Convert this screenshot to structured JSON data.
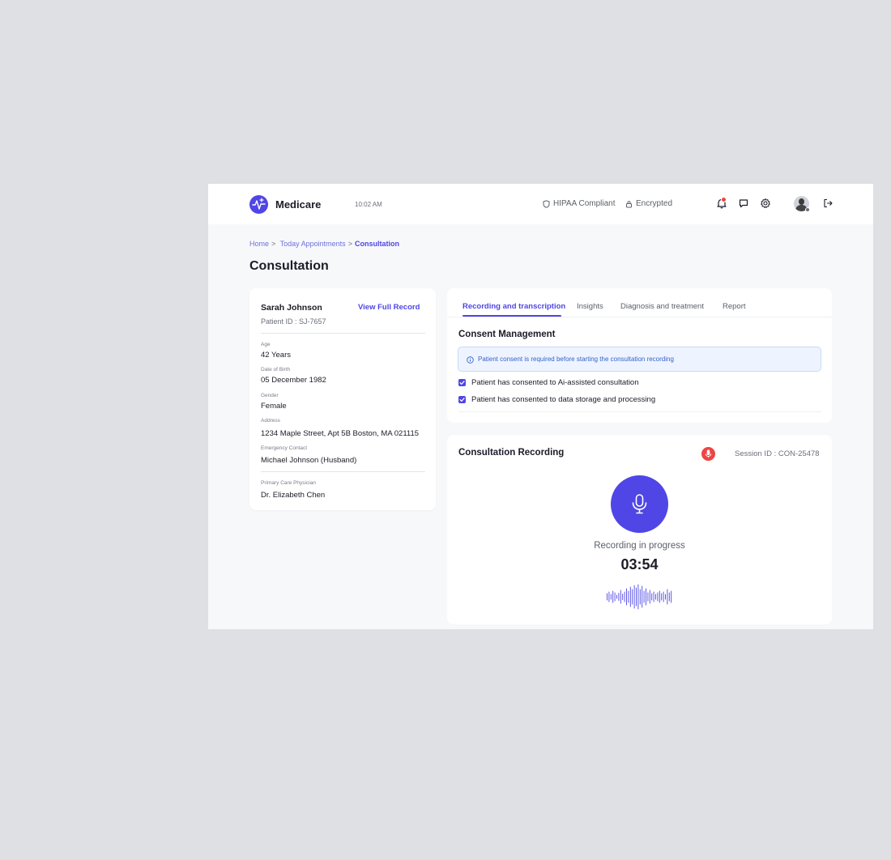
{
  "header": {
    "brand": "Medicare",
    "time": "10:02 AM",
    "hipaa": "HIPAA Compliant",
    "encrypted": "Encrypted",
    "icons": [
      "bell-icon",
      "chat-icon",
      "gear-icon",
      "logout-icon"
    ],
    "notification_color": "#ef4444"
  },
  "breadcrumb": {
    "home": "Home",
    "today": "Today Appointments",
    "current": "Consultation",
    "separator": ">"
  },
  "page": {
    "title": "Consultation"
  },
  "patient": {
    "name": "Sarah Johnson",
    "view_link": "View Full Record",
    "id_text": "Patient ID : SJ-7657",
    "fields": [
      {
        "label": "Age",
        "value": "42 Years"
      },
      {
        "label": "Date of Birth",
        "value": "05 December 1982"
      },
      {
        "label": "Gender",
        "value": "Female"
      },
      {
        "label": "Address",
        "value": "1234 Maple Street, Apt 5B Boston, MA 021115"
      },
      {
        "label": "Emergency Contact",
        "value": "Michael Johnson (Husband)"
      },
      {
        "label": "Primary Care Physician",
        "value": "Dr. Elizabeth Chen"
      }
    ]
  },
  "tabs": [
    {
      "label": "Recording and transcription",
      "active": true
    },
    {
      "label": "Insights",
      "active": false
    },
    {
      "label": "Diagnosis and treatment",
      "active": false
    },
    {
      "label": "Report",
      "active": false
    }
  ],
  "consent": {
    "title": "Consent Management",
    "notice": "Patient consent is required before starting the consultation recording",
    "checks": [
      {
        "label": "Patient has consented to Ai-assisted consultation",
        "checked": true
      },
      {
        "label": "Patient has consented to data storage and processing",
        "checked": true
      }
    ]
  },
  "recording": {
    "title": "Consultation Recording",
    "session": "Session ID : CON-25478",
    "status": "Recording in progress",
    "time": "03:54"
  },
  "colors": {
    "accent": "#4f46e5",
    "record": "#ef4444",
    "notice_bg": "#eef4ff"
  }
}
